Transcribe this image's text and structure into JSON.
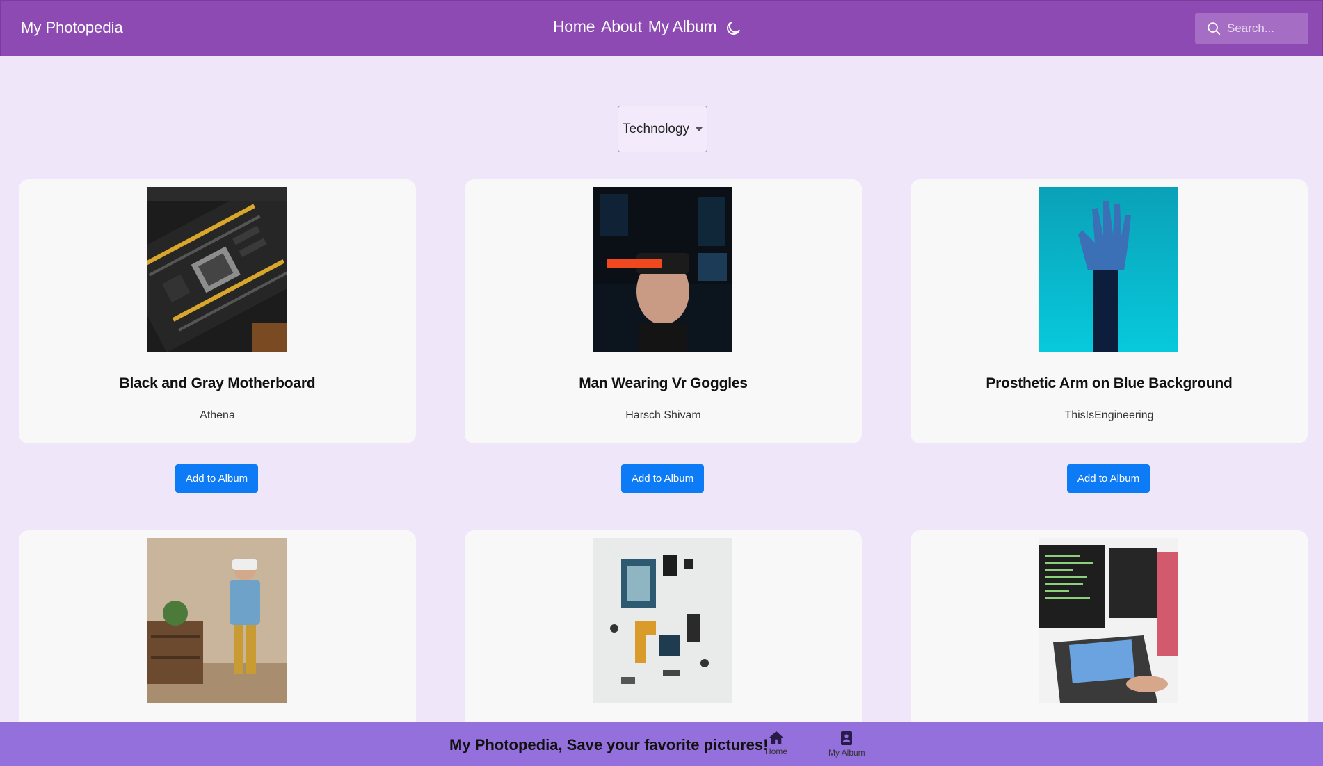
{
  "navbar": {
    "brand": "My Photopedia",
    "links": [
      "Home",
      "About",
      "My Album"
    ],
    "theme_icon": "moon-icon",
    "search_placeholder": "Search...",
    "color": "#8e4ab3"
  },
  "filter": {
    "selected": "Technology"
  },
  "cards": [
    {
      "title": "Black and Gray Motherboard",
      "author": "Athena",
      "button": "Add to Album"
    },
    {
      "title": "Man Wearing Vr Goggles",
      "author": "Harsch Shivam",
      "button": "Add to Album"
    },
    {
      "title": "Prosthetic Arm on Blue Background",
      "author": "ThisIsEngineering",
      "button": "Add to Album"
    },
    {
      "title": "",
      "author": "",
      "button": ""
    },
    {
      "title": "",
      "author": "",
      "button": ""
    },
    {
      "title": "",
      "author": "",
      "button": ""
    }
  ],
  "footer": {
    "tagline": "My Photopedia, Save your favorite pictures!",
    "home_label": "Home",
    "album_label": "My Album",
    "color": "#9470dc"
  },
  "accent_button_color": "#0d7bf5"
}
